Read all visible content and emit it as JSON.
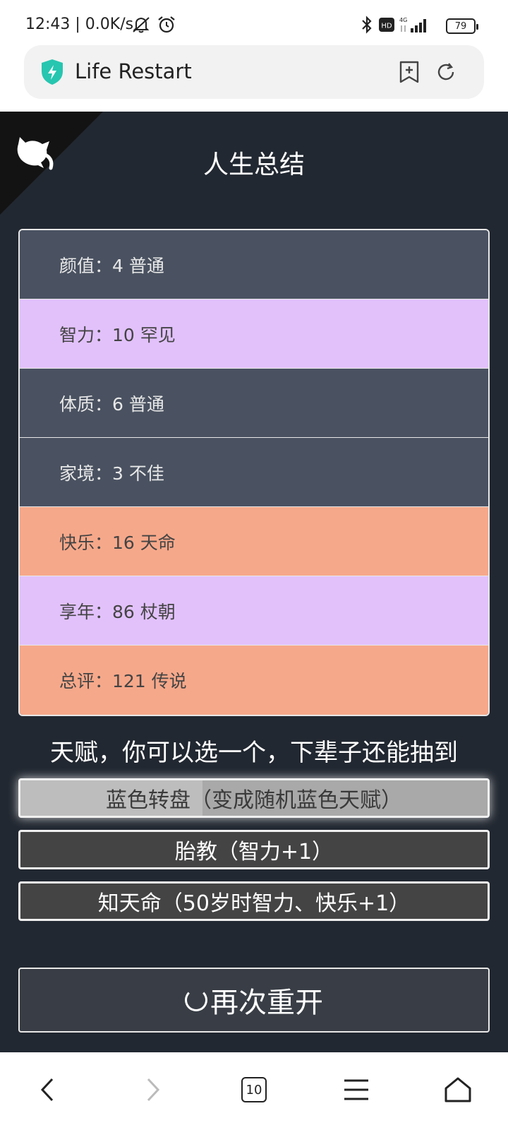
{
  "status_bar": {
    "time_and_speed": "12:43 | 0.0K/s",
    "battery": "79",
    "icons": [
      "mute-icon",
      "alarm-icon",
      "bluetooth-icon",
      "hd-icon",
      "signal-4g-icon",
      "battery-icon"
    ]
  },
  "browser": {
    "page_title": "Life Restart",
    "icons": [
      "shield-icon",
      "add-bookmark-icon",
      "refresh-icon"
    ]
  },
  "app": {
    "title": "人生总结",
    "summary": [
      {
        "label": "颜值：4 普通",
        "grade": "common"
      },
      {
        "label": "智力：10 罕见",
        "grade": "rare"
      },
      {
        "label": "体质：6 普通",
        "grade": "common"
      },
      {
        "label": "家境：3 不佳",
        "grade": "common"
      },
      {
        "label": "快乐：16 天命",
        "grade": "legend"
      },
      {
        "label": "享年：86 杖朝",
        "grade": "rare"
      },
      {
        "label": "总评：121 传说",
        "grade": "legend"
      }
    ],
    "talent_heading": "天赋，你可以选一个，下辈子还能抽到",
    "talents": [
      {
        "label": "蓝色转盘（变成随机蓝色天赋）",
        "selected": true
      },
      {
        "label": "胎教（智力+1）",
        "selected": false
      },
      {
        "label": "知天命（50岁时智力、快乐+1）",
        "selected": false
      }
    ],
    "restart_label": "再次重开",
    "colors": {
      "background": "#222831",
      "common": "#4a5261",
      "rare": "#e2c1fb",
      "legend": "#f6a88a",
      "button": "#444444"
    }
  },
  "nav": {
    "tab_count": "10",
    "icons": [
      "back-icon",
      "forward-icon",
      "tabs-icon",
      "menu-icon",
      "home-icon"
    ]
  }
}
